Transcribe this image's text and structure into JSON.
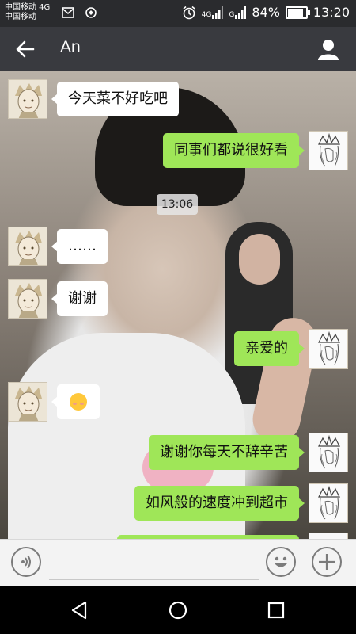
{
  "status_bar": {
    "carrier_line_1": "中国移动 4G",
    "carrier_line_2": "中国移动",
    "network_1": "4G",
    "network_2": "G",
    "battery": "84%",
    "time": "13:20"
  },
  "header": {
    "title": "An",
    "icons": [
      "back-arrow-icon",
      "profile-icon"
    ]
  },
  "chat": {
    "timestamp": "13:06",
    "messages": [
      {
        "side": "left",
        "text": "今天菜不好吃吧"
      },
      {
        "side": "right",
        "text": "同事们都说很好看"
      },
      {
        "side": "left",
        "text": "……"
      },
      {
        "side": "left",
        "text": "谢谢"
      },
      {
        "side": "right",
        "text": "亲爱的"
      },
      {
        "side": "left",
        "emoji": "blushing-smile-emoji"
      },
      {
        "side": "right",
        "text": "谢谢你每天不辞辛苦"
      },
      {
        "side": "right",
        "text": "如风般的速度冲到超市"
      }
    ]
  },
  "input_bar": {
    "value": "",
    "icons": [
      "voice-icon",
      "emoji-icon",
      "plus-icon"
    ]
  },
  "nav_bar": {
    "icons": [
      "back-triangle-icon",
      "home-circle-icon",
      "recents-square-icon"
    ]
  }
}
